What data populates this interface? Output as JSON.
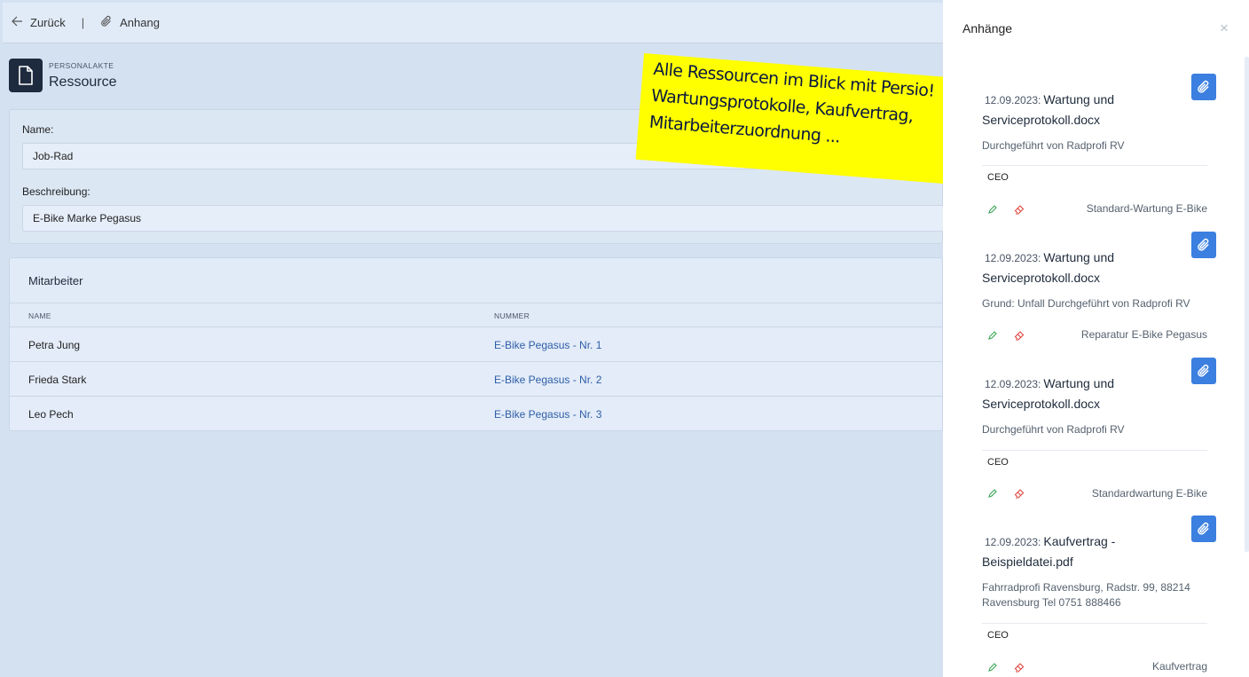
{
  "topbar": {
    "back_label": "Zurück",
    "separator": "|",
    "attachment_label": "Anhang"
  },
  "header": {
    "kicker": "PERSONALAKTE",
    "title": "Ressource"
  },
  "form": {
    "name_label": "Name:",
    "name_value": "Job-Rad",
    "description_label": "Beschreibung:",
    "description_value": "E-Bike Marke Pegasus"
  },
  "employees": {
    "title": "Mitarbeiter",
    "columns": [
      "NAME",
      "NUMMER"
    ],
    "rows": [
      {
        "name": "Petra Jung",
        "number": "E-Bike Pegasus - Nr. 1"
      },
      {
        "name": "Frieda Stark",
        "number": "E-Bike Pegasus - Nr. 2"
      },
      {
        "name": "Leo Pech",
        "number": "E-Bike Pegasus - Nr. 3"
      }
    ]
  },
  "sticky_note": {
    "lines": [
      "Alle Ressourcen im Blick mit Persio!",
      "Wartungsprotokolle, Kaufvertrag,",
      "Mitarbeiterzuordnung ..."
    ]
  },
  "panel": {
    "title": "Anhänge",
    "close": "×",
    "attachments": [
      {
        "date": "12.09.2023:",
        "title": "Wartung und Serviceprotokoll.docx",
        "description": "Durchgeführt von Radprofi RV",
        "tag": "CEO",
        "category": "Standard-Wartung E-Bike"
      },
      {
        "date": "12.09.2023:",
        "title": "Wartung und Serviceprotokoll.docx",
        "description": "Grund: Unfall Durchgeführt von Radprofi RV",
        "tag": "",
        "category": "Reparatur E-Bike Pegasus"
      },
      {
        "date": "12.09.2023:",
        "title": "Wartung und Serviceprotokoll.docx",
        "description": "Durchgeführt von Radprofi RV",
        "tag": "CEO",
        "category": "Standardwartung E-Bike"
      },
      {
        "date": "12.09.2023:",
        "title": "Kaufvertrag - Beispieldatei.pdf",
        "description": "Fahrradprofi Ravensburg, Radstr. 99, 88214 Ravensburg Tel 0751 888466",
        "tag": "CEO",
        "category": "Kaufvertrag"
      }
    ]
  },
  "colors": {
    "accent": "#3b7fe0",
    "link": "#2f5ea8",
    "note": "#ffff00",
    "edit": "#3aa655",
    "delete": "#e0443c"
  },
  "icons": {
    "back": "arrow-left-icon",
    "attachment": "paperclip-icon",
    "document": "document-icon",
    "edit": "pencil-icon",
    "delete": "eraser-icon",
    "close": "close-icon"
  }
}
